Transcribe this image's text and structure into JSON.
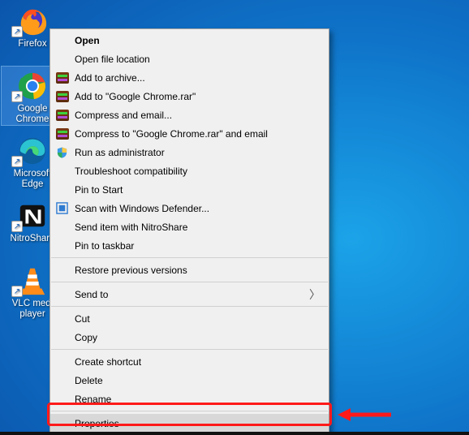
{
  "desktop": {
    "icons": [
      {
        "id": "firefox",
        "label": "Firefox",
        "selected": false
      },
      {
        "id": "chrome",
        "label": "Google\nChrome",
        "selected": true
      },
      {
        "id": "edge",
        "label": "Microsoft\nEdge",
        "selected": false
      },
      {
        "id": "nitroshare",
        "label": "NitroShare",
        "selected": false
      },
      {
        "id": "vlc",
        "label": "VLC medi\nplayer",
        "selected": false
      }
    ]
  },
  "context_menu": {
    "items": [
      {
        "label": "Open",
        "bold": true
      },
      {
        "label": "Open file location"
      },
      {
        "label": "Add to archive...",
        "icon": "rar"
      },
      {
        "label": "Add to \"Google Chrome.rar\"",
        "icon": "rar"
      },
      {
        "label": "Compress and email...",
        "icon": "rar"
      },
      {
        "label": "Compress to \"Google Chrome.rar\" and email",
        "icon": "rar"
      },
      {
        "label": "Run as administrator",
        "icon": "shield"
      },
      {
        "label": "Troubleshoot compatibility"
      },
      {
        "label": "Pin to Start"
      },
      {
        "label": "Scan with Windows Defender...",
        "icon": "defender"
      },
      {
        "label": "Send item with NitroShare"
      },
      {
        "label": "Pin to taskbar"
      },
      {
        "sep": true
      },
      {
        "label": "Restore previous versions"
      },
      {
        "sep": true
      },
      {
        "label": "Send to",
        "submenu": true
      },
      {
        "sep": true
      },
      {
        "label": "Cut"
      },
      {
        "label": "Copy"
      },
      {
        "sep": true
      },
      {
        "label": "Create shortcut"
      },
      {
        "label": "Delete"
      },
      {
        "label": "Rename"
      },
      {
        "sep": true
      },
      {
        "label": "Properties",
        "highlighted": true
      }
    ]
  },
  "annotation": {
    "target_item": "Properties"
  }
}
